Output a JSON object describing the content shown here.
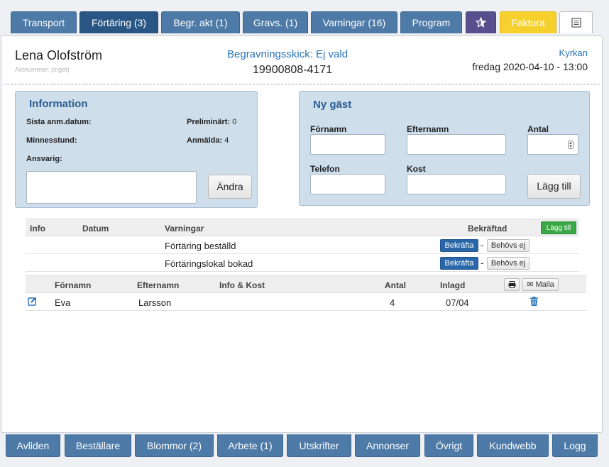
{
  "top_tabs": [
    {
      "label": "Transport",
      "active": false
    },
    {
      "label": "Förtäring (3)",
      "active": true
    },
    {
      "label": "Begr. akt (1)",
      "active": false
    },
    {
      "label": "Gravs. (1)",
      "active": false
    },
    {
      "label": "Varningar (16)",
      "active": false
    },
    {
      "label": "Program",
      "active": false
    },
    {
      "label": "",
      "icon": "star-icon"
    },
    {
      "label": "Faktura"
    },
    {
      "label": "",
      "icon": "notes-icon"
    }
  ],
  "header": {
    "name": "Lena Olofström",
    "aktnummer": "Aktnummer: (inget)",
    "skick": "Begravningsskick: Ej vald",
    "pnr": "19900808-4171",
    "location": "Kyrkan",
    "datetime": "fredag 2020-04-10 - 13:00"
  },
  "information": {
    "title": "Information",
    "sista_anm": "Sista anm.datum:",
    "minnesstund": "Minnesstund:",
    "ansvarig": "Ansvarig:",
    "preliminart_label": "Preliminärt:",
    "preliminart_value": "0",
    "anmalda_label": "Anmälda:",
    "anmalda_value": "4",
    "andra_button": "Ändra"
  },
  "ny_gast": {
    "title": "Ny gäst",
    "fornamn": "Förnamn",
    "efternamn": "Efternamn",
    "antal": "Antal",
    "telefon": "Telefon",
    "kost": "Kost",
    "add_button": "Lägg till"
  },
  "warnings": {
    "headers": {
      "info": "Info",
      "datum": "Datum",
      "varningar": "Varningar",
      "bekraftad": "Bekräftad"
    },
    "add_button": "Lägg till",
    "rows": [
      {
        "text": "Förtäring beställd",
        "confirm": "Bekräfta",
        "sep": "-",
        "not_needed": "Behövs ej"
      },
      {
        "text": "Förtäringslokal bokad",
        "confirm": "Bekräfta",
        "sep": "-",
        "not_needed": "Behövs ej"
      }
    ]
  },
  "guests": {
    "headers": {
      "fornamn": "Förnamn",
      "efternamn": "Efternamn",
      "info_kost": "Info & Kost",
      "antal": "Antal",
      "inlagd": "Inlagd"
    },
    "mail_button": "Maila",
    "rows": [
      {
        "fornamn": "Eva",
        "efternamn": "Larsson",
        "info_kost": "",
        "antal": "4",
        "inlagd": "07/04"
      }
    ]
  },
  "bottom_tabs": [
    {
      "label": "Avliden"
    },
    {
      "label": "Beställare"
    },
    {
      "label": "Blommor (2)"
    },
    {
      "label": "Arbete (1)"
    },
    {
      "label": "Utskrifter"
    },
    {
      "label": "Annonser"
    },
    {
      "label": "Övrigt"
    },
    {
      "label": "Kundwebb"
    },
    {
      "label": "Logg"
    }
  ],
  "colors": {
    "tab_blue": "#4e7aa7",
    "tab_active": "#2a5685",
    "invoice_yellow": "#f6d02c",
    "link_blue": "#2a74b8",
    "panel_bg": "#cfdeeb",
    "confirm_blue": "#2a67a8",
    "add_green": "#3aa845"
  }
}
